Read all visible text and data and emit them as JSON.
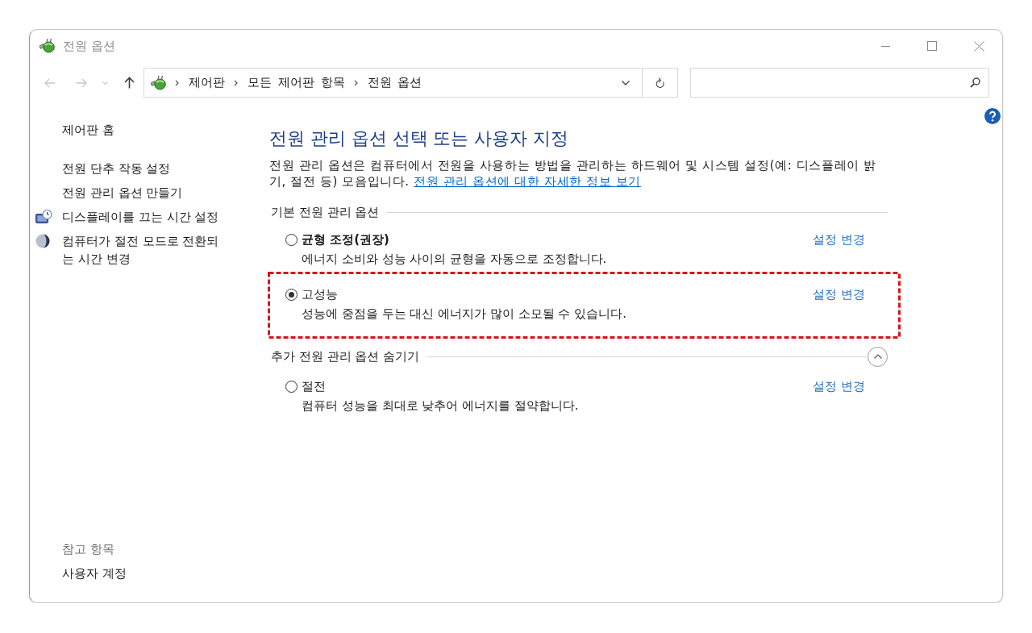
{
  "window": {
    "title": "전원 옵션"
  },
  "navigation": [
    {
      "kind": "back",
      "disabled": true
    },
    {
      "kind": "forward",
      "disabled": true
    },
    {
      "kind": "recent",
      "disabled": true
    },
    {
      "kind": "up",
      "disabled": false
    }
  ],
  "address_bar": {
    "breadcrumbs": [
      "제어판",
      "모든 제어판 항목",
      "전원 옵션"
    ]
  },
  "sidebar": {
    "home": "제어판 홈",
    "links": [
      {
        "kind": "plain",
        "label": "전원 단추 작동 설정"
      },
      {
        "kind": "plain",
        "label": "전원 관리 옵션 만들기"
      },
      {
        "kind": "display",
        "label": "디스플레이를 끄는 시간 설정"
      },
      {
        "kind": "sleep",
        "label": "컴퓨터가 절전 모드로 전환되는 시간 변경"
      }
    ],
    "see_also": {
      "heading": "참고 항목",
      "links": [
        "사용자 계정"
      ]
    }
  },
  "main": {
    "title": "전원 관리 옵션 선택 또는 사용자 지정",
    "description": "전원 관리 옵션은 컴퓨터에서 전원을 사용하는 방법을 관리하는 하드웨어 및 시스템 설정(예: 디스플레이 밝기, 절전 등) 모음입니다.",
    "info_link": "전원 관리 옵션에 대한 자세한 정보 보기"
  },
  "basic_group": {
    "heading": "기본 전원 관리 옵션",
    "plans": [
      {
        "name": "균형 조정(권장)",
        "bold": true,
        "selected": false,
        "highlighted": false,
        "description": "에너지 소비와 성능 사이의 균형을 자동으로 조정합니다.",
        "action": "설정 변경"
      },
      {
        "name": "고성능",
        "bold": false,
        "selected": true,
        "highlighted": true,
        "description": "성능에 중점을 두는 대신 에너지가 많이 소모될 수 있습니다.",
        "action": "설정 변경"
      }
    ]
  },
  "additional_group": {
    "heading": "추가 전원 관리 옵션 숨기기",
    "expanded": true,
    "plans": [
      {
        "name": "절전",
        "bold": false,
        "selected": false,
        "highlighted": false,
        "description": "컴퓨터 성능을 최대로 낮추어 에너지를 절약합니다.",
        "action": "설정 변경"
      }
    ]
  }
}
